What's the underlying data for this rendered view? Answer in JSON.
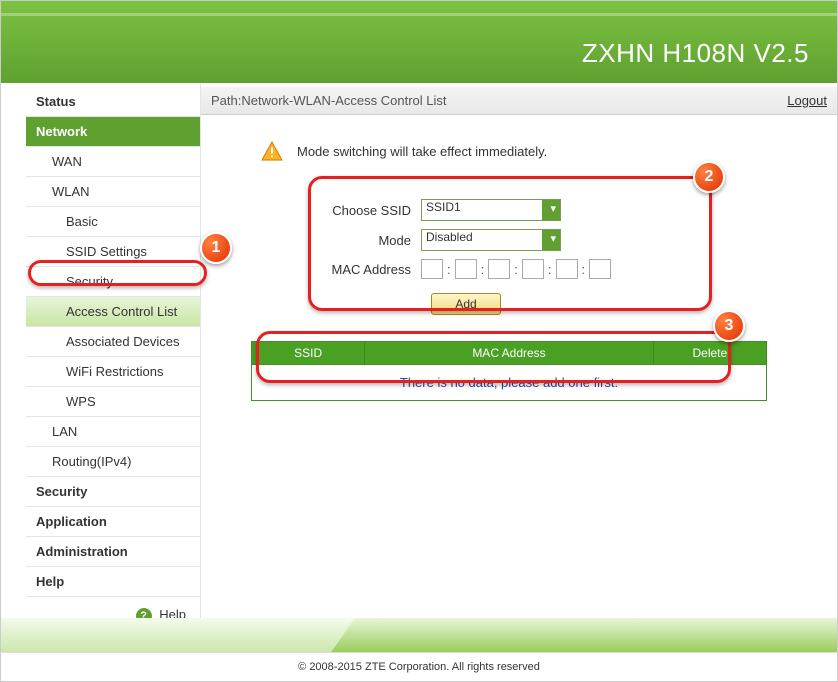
{
  "header": {
    "title": "ZXHN H108N V2.5"
  },
  "sidebar": {
    "status": "Status",
    "network": "Network",
    "wan": "WAN",
    "wlan": "WLAN",
    "basic": "Basic",
    "ssid_settings": "SSID Settings",
    "security": "Security",
    "acl": "Access Control List",
    "assoc": "Associated Devices",
    "wifi_restrict": "WiFi Restrictions",
    "wps": "WPS",
    "lan": "LAN",
    "routing": "Routing(IPv4)",
    "sec": "Security",
    "app": "Application",
    "admin": "Administration",
    "help_section": "Help",
    "help_label": "Help"
  },
  "breadcrumb": "Path:Network-WLAN-Access Control List",
  "logout": "Logout",
  "notice": "Mode switching will take effect immediately.",
  "form": {
    "choose_ssid_label": "Choose SSID",
    "ssid_value": "SSID1",
    "mode_label": "Mode",
    "mode_value": "Disabled",
    "mac_label": "MAC Address",
    "add_btn": "Add"
  },
  "table": {
    "col_ssid": "SSID",
    "col_mac": "MAC Address",
    "col_delete": "Delete",
    "empty": "There is no data, please add one first."
  },
  "footer": {
    "copyright": "© 2008-2015 ZTE Corporation. All rights reserved"
  }
}
